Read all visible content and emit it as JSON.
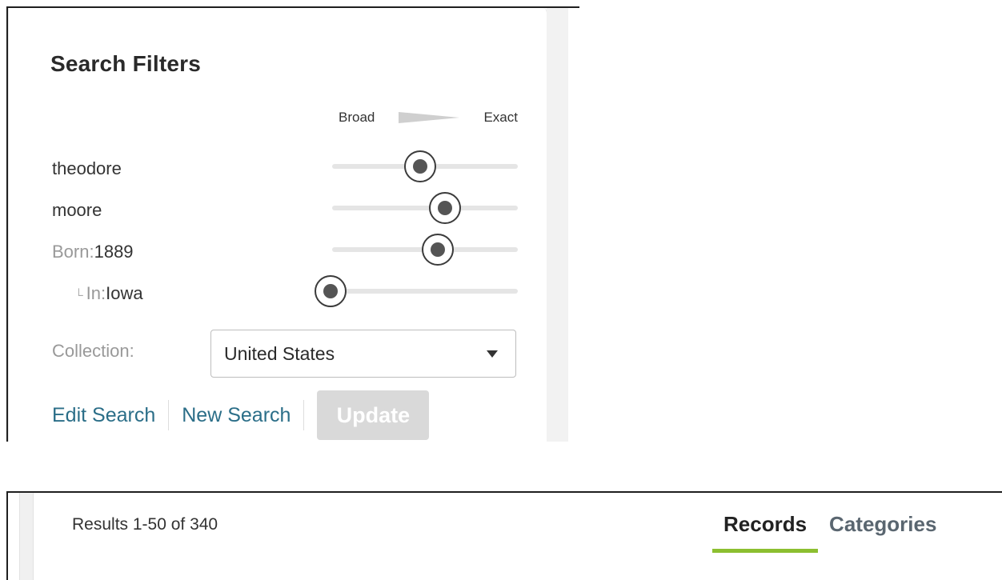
{
  "search_filters": {
    "title": "Search Filters",
    "scale": {
      "broad_label": "Broad",
      "exact_label": "Exact"
    },
    "filters": [
      {
        "prefix": "",
        "value": "theodore",
        "level": 0.5
      },
      {
        "prefix": "",
        "value": "moore",
        "level": 0.64
      },
      {
        "prefix": "Born:",
        "value": "1889",
        "level": 0.6
      },
      {
        "indent_mark": "└",
        "prefix": "In:",
        "value": "Iowa",
        "level": 0.0
      }
    ],
    "collection": {
      "label": "Collection:",
      "selected": "United States"
    },
    "actions": {
      "edit_search": "Edit Search",
      "new_search": "New Search",
      "update": "Update"
    }
  },
  "results_bar": {
    "results_text": "Results 1-50 of 340",
    "tabs": [
      {
        "label": "Records",
        "active": true
      },
      {
        "label": "Categories",
        "active": false
      }
    ]
  },
  "colors": {
    "link": "#2b6e88",
    "tab_underline": "#8cbf30",
    "update_disabled": "#d9d9d9"
  }
}
